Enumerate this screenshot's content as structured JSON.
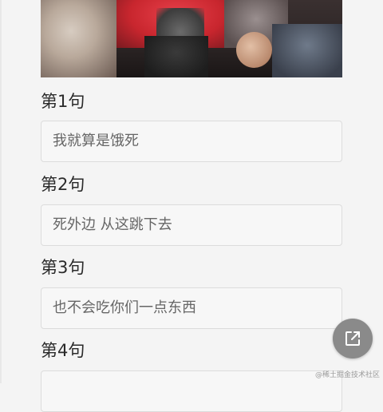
{
  "sentences": [
    {
      "label": "第1句",
      "value": "我就算是饿死"
    },
    {
      "label": "第2句",
      "value": "死外边 从这跳下去"
    },
    {
      "label": "第3句",
      "value": "也不会吃你们一点东西"
    },
    {
      "label": "第4句",
      "value": ""
    }
  ],
  "share_button": {
    "icon": "share-icon"
  },
  "watermark": "@稀土掘金技术社区"
}
